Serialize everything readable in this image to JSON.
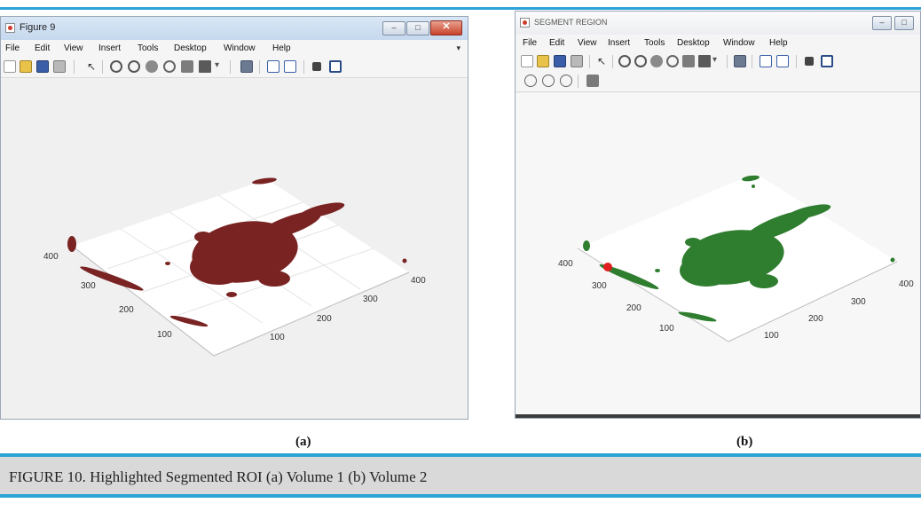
{
  "figure_a": {
    "window_title": "Figure 9",
    "menu": [
      "File",
      "Edit",
      "View",
      "Insert",
      "Tools",
      "Desktop",
      "Window",
      "Help"
    ],
    "axes": {
      "left_ticks": [
        "400",
        "300",
        "200",
        "100"
      ],
      "right_ticks": [
        "400",
        "300",
        "200",
        "100"
      ]
    },
    "blob_color": "#7a2323",
    "label": "(a)"
  },
  "figure_b": {
    "window_title": "SEGMENT REGION",
    "menu": [
      "File",
      "Edit",
      "View",
      "Insert",
      "Tools",
      "Desktop",
      "Window",
      "Help"
    ],
    "axes": {
      "left_ticks": [
        "400",
        "300",
        "200",
        "100"
      ],
      "right_ticks": [
        "400",
        "300",
        "200",
        "100"
      ]
    },
    "blob_color": "#2f7d2f",
    "marker_color": "#e02020",
    "label": "(b)"
  },
  "caption": "FIGURE 10. Highlighted Segmented ROI (a) Volume 1 (b) Volume 2",
  "accent_color": "#2ba3d6"
}
